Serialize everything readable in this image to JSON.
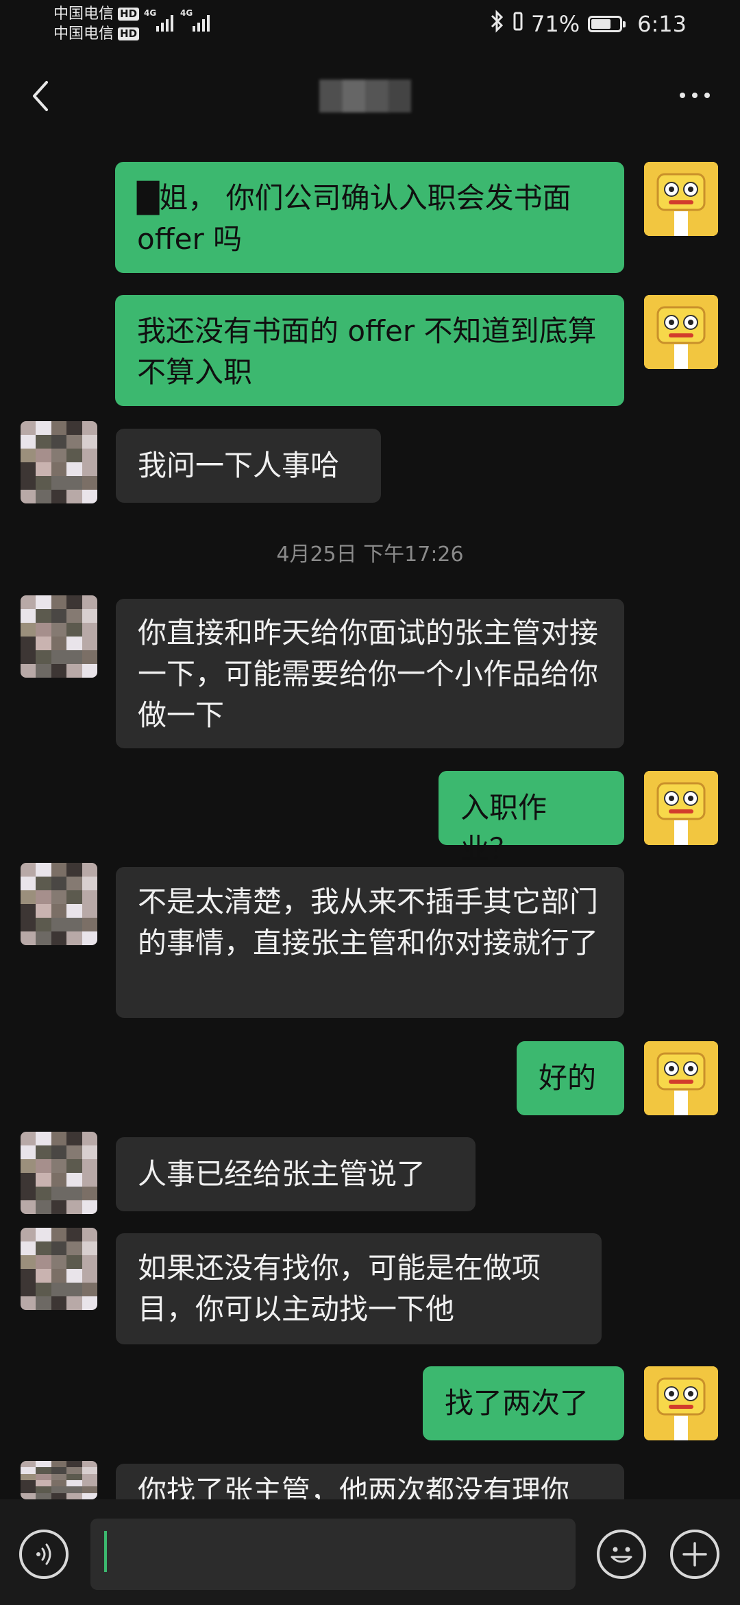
{
  "status_bar": {
    "carrier_1": "中国电信",
    "carrier_2": "中国电信",
    "hd_label": "HD",
    "network_1": "4G",
    "network_2": "4G",
    "battery_percent": "71%",
    "battery_level": 0.71,
    "time": "6:13"
  },
  "messages": [
    {
      "sender": "me",
      "text": "█姐， 你们公司确认入职会发书面 offer 吗"
    },
    {
      "sender": "me",
      "text": "我还没有书面的 offer 不知道到底算不算入职"
    },
    {
      "sender": "other",
      "text": "我问一下人事哈"
    },
    {
      "sender": "other",
      "text": "你直接和昨天给你面试的张主管对接一下，可能需要给你一个小作品给你做一下"
    },
    {
      "sender": "me",
      "text": "入职作业？"
    },
    {
      "sender": "other",
      "text": "不是太清楚，我从来不插手其它部门的事情，直接张主管和你对接就行了"
    },
    {
      "sender": "me",
      "text": "好的"
    },
    {
      "sender": "other",
      "text": "人事已经给张主管说了"
    },
    {
      "sender": "other",
      "text": "如果还没有找你，可能是在做项目，你可以主动找一下他"
    },
    {
      "sender": "me",
      "text": "找了两次了"
    },
    {
      "sender": "other",
      "text": "你找了张主管，他两次都没有理你"
    }
  ],
  "timestamp": "4月25日 下午17:26",
  "colors": {
    "background": "#111111",
    "bubble_me": "#3cb86f",
    "bubble_other": "#2c2c2c",
    "cursor": "#3cb86f"
  },
  "icons": {
    "back": "back-arrow-icon",
    "more": "more-dots-icon",
    "voice": "voice-icon",
    "emoji": "emoji-icon",
    "plus": "plus-icon"
  }
}
